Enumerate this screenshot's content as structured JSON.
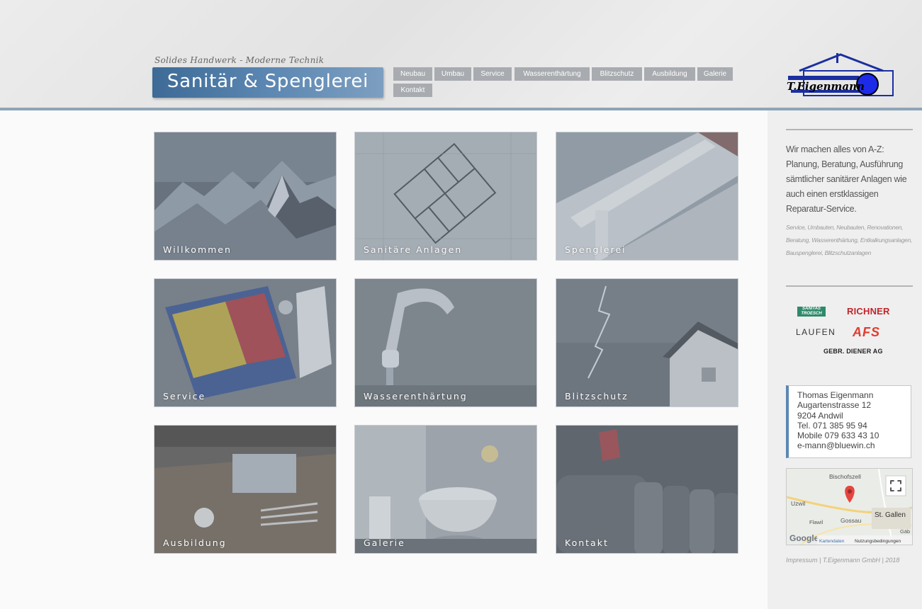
{
  "header": {
    "tagline": "Solides Handwerk - Moderne Technik",
    "title": "Sanitär & Spenglerei",
    "logo_text": "T.Eigenmann"
  },
  "nav": {
    "items": [
      "Neubau",
      "Umbau",
      "Service",
      "Wasserenthärtung",
      "Blitzschutz",
      "Ausbildung",
      "Galerie",
      "Kontakt"
    ]
  },
  "tiles": [
    {
      "label": "Willkommen",
      "image": "mountain-landscape"
    },
    {
      "label": "Sanitäre Anlagen",
      "image": "floor-plan"
    },
    {
      "label": "Spenglerei",
      "image": "roof-gutter"
    },
    {
      "label": "Service",
      "image": "toolbox-parts"
    },
    {
      "label": "Wasserenthärtung",
      "image": "water-faucet"
    },
    {
      "label": "Blitzschutz",
      "image": "lightning-storm"
    },
    {
      "label": "Ausbildung",
      "image": "workbench-tools"
    },
    {
      "label": "Galerie",
      "image": "bathroom-tub"
    },
    {
      "label": "Kontakt",
      "image": "mailboxes"
    }
  ],
  "sidebar": {
    "intro": "Wir machen alles von A-Z: Planung, Beratung, Ausführung sämtlicher sanitärer Anlagen wie auch einen erstklassigen Reparatur-Service.",
    "keywords": "Service, Umbauten, Neubauten, Renovationen, Beratung, Wasserenthärtung, Entkalkungsanlagen, Bauspenglerei, Blitzschutzanlagen",
    "brands": [
      "SANITAS TROESCH",
      "RICHNER",
      "LAUFEN",
      "AFS",
      "GEBR. DIENER AG"
    ],
    "address": [
      "Thomas Eigenmann",
      "Augartenstrasse 12",
      "9204 Andwil",
      "Tel. 071 385 95 94",
      "Mobile 079 633 43 10",
      "e-mann@bluewin.ch"
    ],
    "map": {
      "places": [
        "Bischofszell",
        "Uzwil",
        "Gossau",
        "St. Gallen",
        "Flawil",
        "Gäb"
      ],
      "attribution": "Kartendaten",
      "terms": "Nutzungsbedingungen",
      "google": "Google"
    },
    "footer": "Impressum | T.Eigenmann GmbH | 2018"
  },
  "colors": {
    "accent": "#5b87b2",
    "nav_bg": "#a8abaf",
    "header_line": "#8fa4b8"
  }
}
